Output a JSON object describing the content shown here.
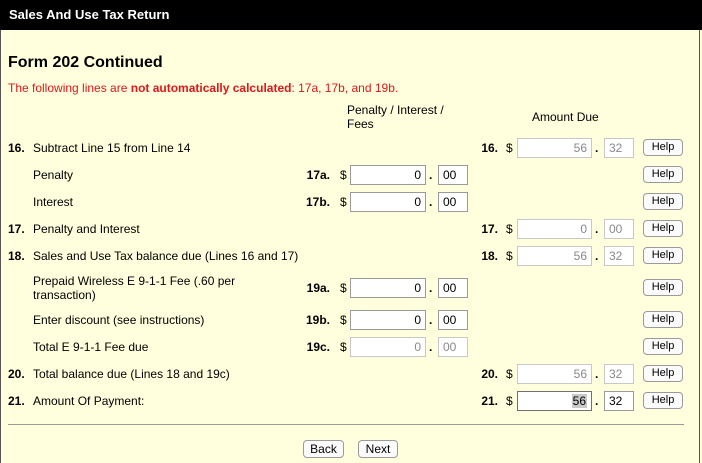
{
  "window": {
    "title": "Sales And Use Tax Return"
  },
  "form": {
    "title": "Form 202 Continued",
    "notice_prefix": "The following lines are ",
    "notice_bold": "not automatically calculated",
    "notice_suffix": ": 17a, 17b, and 19b."
  },
  "headers": {
    "penalty_interest_line1": "Penalty / Interest /",
    "penalty_interest_line2": "Fees",
    "amount_due": "Amount Due"
  },
  "currency_symbol": "$",
  "decimal_sep": ".",
  "help_label": "Help",
  "rows": {
    "r16": {
      "num": "16.",
      "label": "Subtract Line 15 from Line 14",
      "code": "16.",
      "dollars": "56",
      "cents": "32"
    },
    "r17a": {
      "label": "Penalty",
      "code": "17a.",
      "dollars": "0",
      "cents": "00"
    },
    "r17b": {
      "label": "Interest",
      "code": "17b.",
      "dollars": "0",
      "cents": "00"
    },
    "r17": {
      "num": "17.",
      "label": "Penalty and Interest",
      "code": "17.",
      "dollars": "0",
      "cents": "00"
    },
    "r18": {
      "num": "18.",
      "label": "Sales and Use Tax balance due (Lines 16 and 17)",
      "code": "18.",
      "dollars": "56",
      "cents": "32"
    },
    "r19a": {
      "label_line1": "Prepaid Wireless E 9-1-1 Fee (.60 per",
      "label_line2": "transaction)",
      "code": "19a.",
      "dollars": "0",
      "cents": "00"
    },
    "r19b": {
      "label": "Enter discount (see instructions)",
      "code": "19b.",
      "dollars": "0",
      "cents": "00"
    },
    "r19c": {
      "label": "Total E 9-1-1 Fee due",
      "code": "19c.",
      "dollars": "0",
      "cents": "00"
    },
    "r20": {
      "num": "20.",
      "label": "Total balance due (Lines 18 and 19c)",
      "code": "20.",
      "dollars": "56",
      "cents": "32"
    },
    "r21": {
      "num": "21.",
      "label": "Amount Of Payment:",
      "code": "21.",
      "dollars": "56",
      "cents": "32"
    }
  },
  "nav": {
    "back": "Back",
    "next": "Next"
  }
}
